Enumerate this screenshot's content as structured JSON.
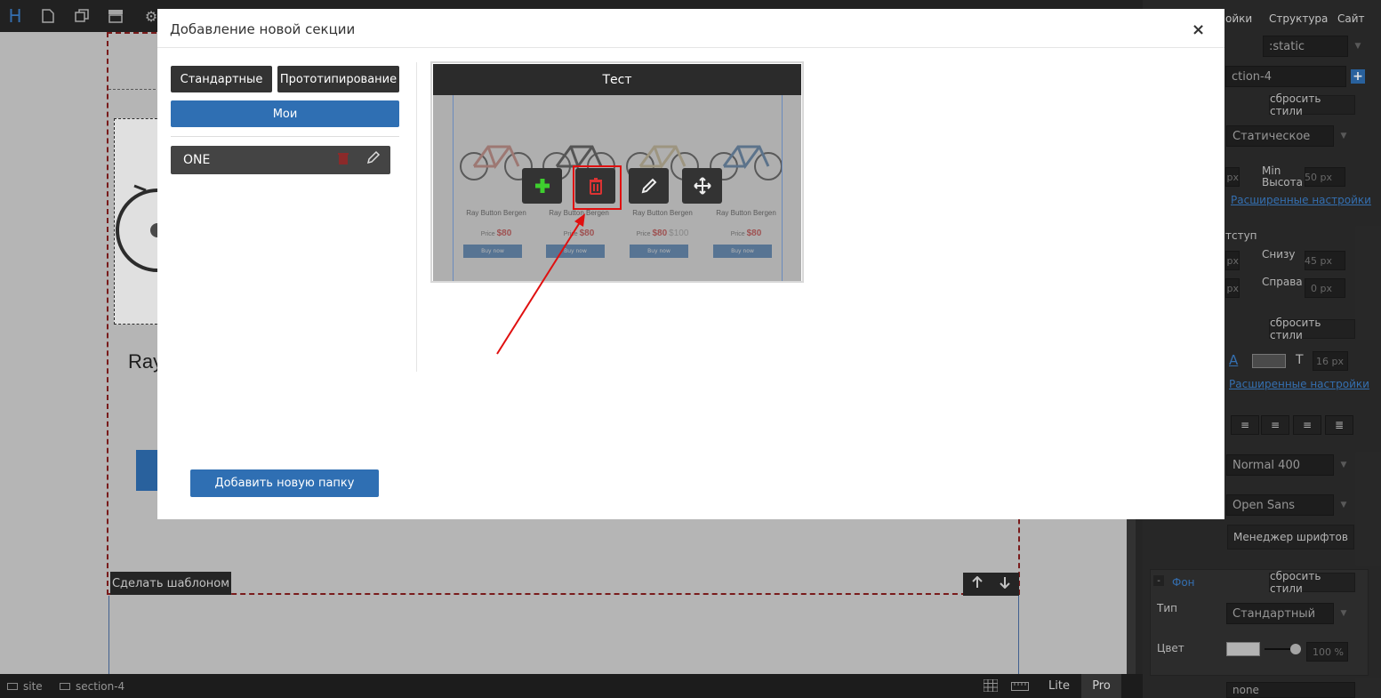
{
  "topbar": {
    "logo": "H"
  },
  "canvas": {
    "partial_heading": "Ray",
    "make_template_label": "Сделать шаблоном",
    "arrow_up": "🡑",
    "arrow_down": "🡓"
  },
  "status": {
    "crumb_site": "site",
    "crumb_section": "section-4",
    "lite": "Lite",
    "pro": "Pro"
  },
  "right_panel": {
    "tab_settings_partial": "ойки",
    "tab_structure": "Структура",
    "tab_site": "Сайт",
    "state_select": ":static",
    "section_id_partial": "ction-4",
    "reset_styles_1": "сбросить стили",
    "position_select": "Статическое",
    "min_label": "Min",
    "height_label": "Высота",
    "min_height_value": "50",
    "unit_px": "px",
    "advanced_settings_1": "Расширенные настройки",
    "indent_partial": "тступ",
    "bottom_label": "Снизу",
    "bottom_value": "45",
    "right_label": "Справа",
    "right_value": "0",
    "reset_styles_2": "сбросить стили",
    "font_size_value": "16",
    "advanced_settings_2": "Расширенные настройки",
    "weight_select": "Normal 400",
    "font_select": "Open Sans",
    "font_manager": "Менеджер шрифтов",
    "bg_toggle": "-",
    "bg_label": "Фон",
    "reset_styles_3": "сбросить стили",
    "type_label": "Тип",
    "type_select": "Стандартный",
    "color_label": "Цвет",
    "opacity_value": "100 %",
    "last_select": "none"
  },
  "modal": {
    "title": "Добавление новой секции",
    "close": "×",
    "tab_standard": "Стандартные",
    "tab_prototyping": "Прототипирование",
    "tab_my": "Мои",
    "folder_name": "ONE",
    "add_folder_button": "Добавить новую папку",
    "card": {
      "title": "Тест",
      "products": [
        {
          "name": "Ray Button Bergen",
          "price_label": "Price",
          "price": "$80",
          "old_price": ""
        },
        {
          "name": "Ray Button Bergen",
          "price_label": "Price",
          "price": "$80",
          "old_price": ""
        },
        {
          "name": "Ray Button Bergen",
          "price_label": "Price",
          "price": "$80",
          "old_price": "$100"
        },
        {
          "name": "Ray Button Bergen",
          "price_label": "Price",
          "price": "$80",
          "old_price": ""
        }
      ],
      "buy_label": "Buy now"
    }
  },
  "colors": {
    "accent_blue": "#2f6fb3",
    "annotation_red": "#e01010",
    "add_green": "#3ecf2e"
  }
}
